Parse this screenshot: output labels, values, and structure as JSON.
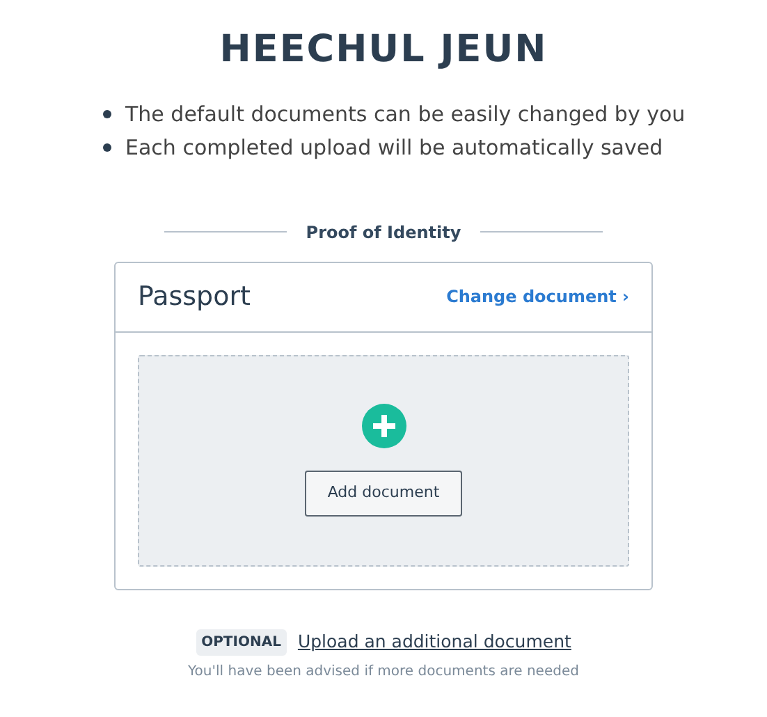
{
  "title": "HEECHUL JEUN",
  "notes": [
    "The default documents can be easily changed by you",
    "Each completed upload will be automatically saved"
  ],
  "section": {
    "heading": "Proof of Identity",
    "card": {
      "title": "Passport",
      "change_link": "Change document ›",
      "add_button": "Add document"
    }
  },
  "optional": {
    "badge": "OPTIONAL",
    "link": "Upload an additional document",
    "hint": "You'll have been advised if more documents are needed"
  }
}
